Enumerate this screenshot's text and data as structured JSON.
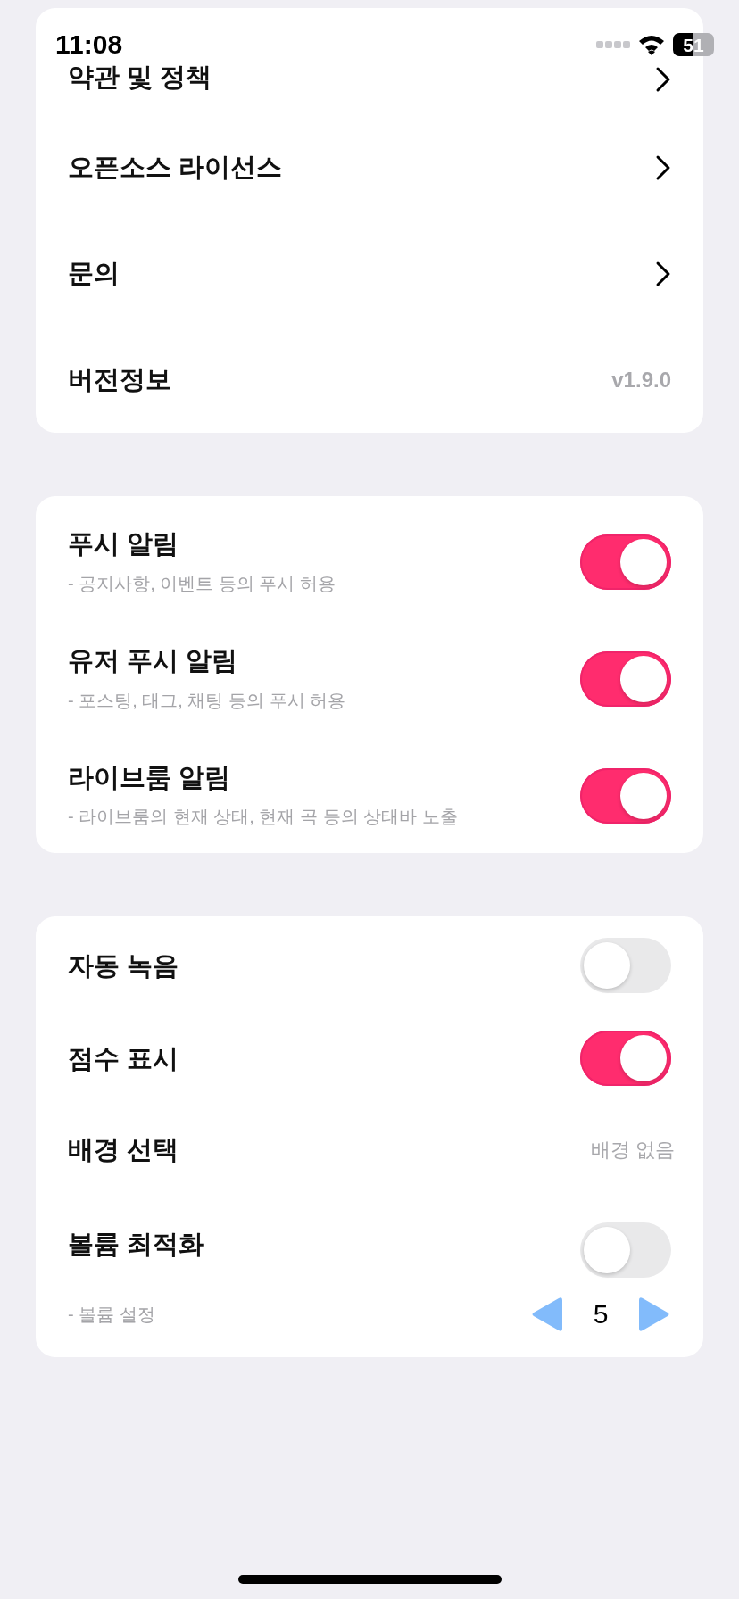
{
  "status_bar": {
    "time": "11:08",
    "battery": "51"
  },
  "sections": [
    {
      "rows": [
        {
          "kind": "link",
          "title": "약관 및 정책"
        },
        {
          "kind": "link",
          "title": "오픈소스 라이선스"
        },
        {
          "kind": "link",
          "title": "문의"
        },
        {
          "kind": "version",
          "title": "버전정보",
          "value": "v1.9.0"
        }
      ]
    },
    {
      "rows": [
        {
          "kind": "toggle",
          "title": "푸시 알림",
          "subtitle": "- 공지사항, 이벤트 등의 푸시 허용",
          "on": true
        },
        {
          "kind": "toggle",
          "title": "유저 푸시 알림",
          "subtitle": "- 포스팅, 태그, 채팅 등의 푸시 허용",
          "on": true
        },
        {
          "kind": "toggle",
          "title": "라이브룸 알림",
          "subtitle": "- 라이브룸의 현재 상태, 현재 곡 등의 상태바 노출",
          "on": true
        }
      ]
    },
    {
      "rows": [
        {
          "kind": "toggle",
          "title": "자동 녹음",
          "on": false
        },
        {
          "kind": "toggle",
          "title": "점수 표시",
          "on": true
        },
        {
          "kind": "choice",
          "title": "배경 선택",
          "value": "배경 없음"
        },
        {
          "kind": "toggle",
          "title": "볼륨 최적화",
          "on": false,
          "subtitle": "- 볼륨 설정",
          "stepper": "5"
        }
      ]
    }
  ]
}
